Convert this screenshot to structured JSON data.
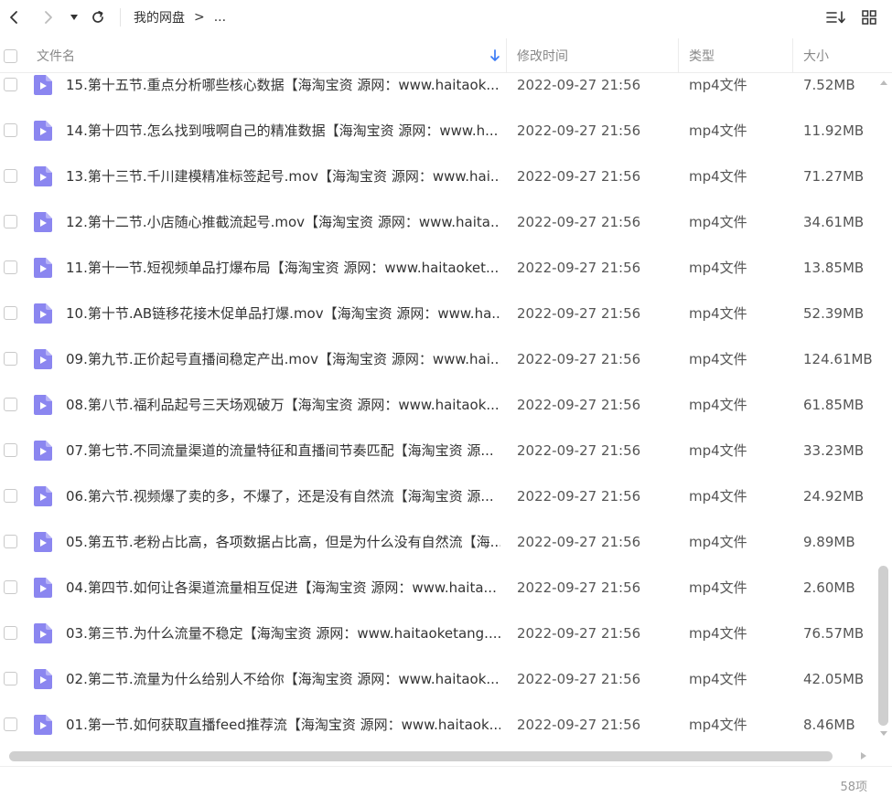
{
  "breadcrumb": {
    "root": "我的网盘",
    "separator": ">",
    "more": "..."
  },
  "columns": {
    "name": "文件名",
    "modified": "修改时间",
    "type": "类型",
    "size": "大小"
  },
  "icons": {
    "back": "chevron-left-icon",
    "forward": "chevron-right-icon",
    "dropdown": "caret-down-icon",
    "refresh": "refresh-icon",
    "sort": "sort-icon",
    "grid": "grid-view-icon",
    "sort_arrow": "arrow-down-icon",
    "file": "video-file-icon"
  },
  "colors": {
    "accent": "#3b7bf6",
    "file_icon": "#8b86f0"
  },
  "files": [
    {
      "name": "15.第十五节.重点分析哪些核心数据【海淘宝资 源网：www.haitaok...",
      "date": "2022-09-27 21:56",
      "type": "mp4文件",
      "size": "7.52MB"
    },
    {
      "name": "14.第十四节.怎么找到哦啊自己的精准数据【海淘宝资 源网：www.h...",
      "date": "2022-09-27 21:56",
      "type": "mp4文件",
      "size": "11.92MB"
    },
    {
      "name": "13.第十三节.千川建模精准标签起号.mov【海淘宝资 源网：www.hai...",
      "date": "2022-09-27 21:56",
      "type": "mp4文件",
      "size": "71.27MB"
    },
    {
      "name": "12.第十二节.小店随心推截流起号.mov【海淘宝资 源网：www.haita...",
      "date": "2022-09-27 21:56",
      "type": "mp4文件",
      "size": "34.61MB"
    },
    {
      "name": "11.第十一节.短视频单品打爆布局【海淘宝资 源网：www.haitaoket...",
      "date": "2022-09-27 21:56",
      "type": "mp4文件",
      "size": "13.85MB"
    },
    {
      "name": "10.第十节.AB链移花接木促单品打爆.mov【海淘宝资 源网：www.ha...",
      "date": "2022-09-27 21:56",
      "type": "mp4文件",
      "size": "52.39MB"
    },
    {
      "name": "09.第九节.正价起号直播间稳定产出.mov【海淘宝资 源网：www.hai...",
      "date": "2022-09-27 21:56",
      "type": "mp4文件",
      "size": "124.61MB"
    },
    {
      "name": "08.第八节.福利品起号三天场观破万【海淘宝资 源网：www.haitaok...",
      "date": "2022-09-27 21:56",
      "type": "mp4文件",
      "size": "61.85MB"
    },
    {
      "name": "07.第七节.不同流量渠道的流量特征和直播间节奏匹配【海淘宝资 源...",
      "date": "2022-09-27 21:56",
      "type": "mp4文件",
      "size": "33.23MB"
    },
    {
      "name": "06.第六节.视频爆了卖的多，不爆了，还是没有自然流【海淘宝资 源...",
      "date": "2022-09-27 21:56",
      "type": "mp4文件",
      "size": "24.92MB"
    },
    {
      "name": "05.第五节.老粉占比高，各项数据占比高，但是为什么没有自然流【海...",
      "date": "2022-09-27 21:56",
      "type": "mp4文件",
      "size": "9.89MB"
    },
    {
      "name": "04.第四节.如何让各渠道流量相互促进【海淘宝资 源网：www.haita...",
      "date": "2022-09-27 21:56",
      "type": "mp4文件",
      "size": "2.60MB"
    },
    {
      "name": "03.第三节.为什么流量不稳定【海淘宝资 源网：www.haitaoketang....",
      "date": "2022-09-27 21:56",
      "type": "mp4文件",
      "size": "76.57MB"
    },
    {
      "name": "02.第二节.流量为什么给别人不给你【海淘宝资 源网：www.haitaok...",
      "date": "2022-09-27 21:56",
      "type": "mp4文件",
      "size": "42.05MB"
    },
    {
      "name": "01.第一节.如何获取直播feed推荐流【海淘宝资 源网：www.haitaok...",
      "date": "2022-09-27 21:56",
      "type": "mp4文件",
      "size": "8.46MB"
    }
  ],
  "status": {
    "item_count": "58项"
  }
}
